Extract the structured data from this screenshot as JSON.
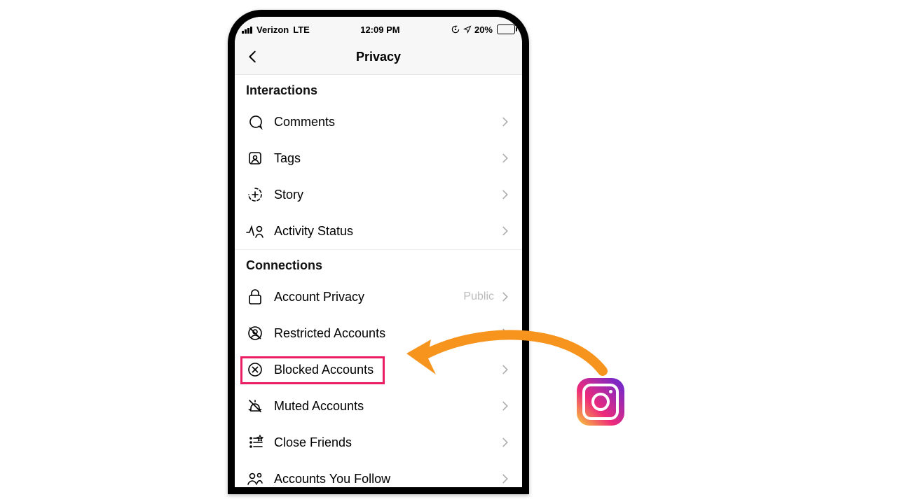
{
  "status": {
    "carrier": "Verizon",
    "network": "LTE",
    "time": "12:09 PM",
    "battery_text": "20%"
  },
  "header": {
    "title": "Privacy"
  },
  "sections": {
    "interactions": {
      "title": "Interactions",
      "comments": "Comments",
      "tags": "Tags",
      "story": "Story",
      "activity_status": "Activity Status"
    },
    "connections": {
      "title": "Connections",
      "account_privacy": "Account Privacy",
      "account_privacy_value": "Public",
      "restricted": "Restricted Accounts",
      "blocked": "Blocked Accounts",
      "muted": "Muted Accounts",
      "close_friends": "Close Friends",
      "accounts_follow": "Accounts You Follow"
    }
  },
  "annotation": {
    "arrow_color": "#f7941d",
    "highlight_color": "#e91e63",
    "brand": "instagram"
  }
}
